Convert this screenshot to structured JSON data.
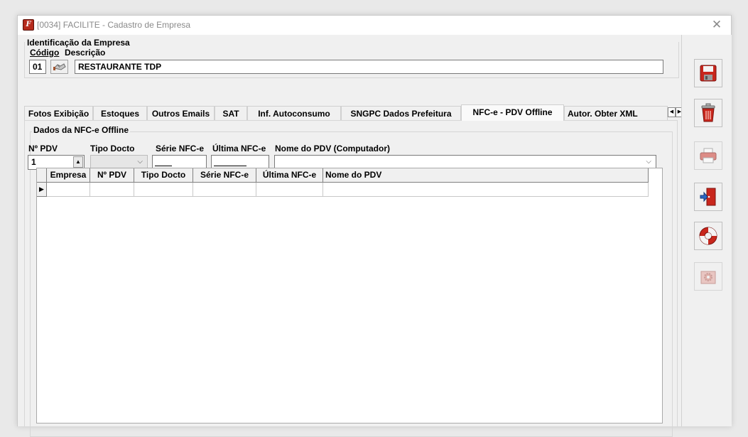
{
  "window": {
    "title": "[0034] FACILITE - Cadastro de Empresa",
    "close_glyph": "✕",
    "app_icon_letter": "F"
  },
  "identificacao": {
    "group_title": "Identificação da Empresa",
    "codigo_label": "Código",
    "descricao_label": "Descrição",
    "codigo_value": "01",
    "descricao_value": "RESTAURANTE TDP"
  },
  "tabs": [
    {
      "label": "Fotos Exibição",
      "active": false
    },
    {
      "label": "Estoques",
      "active": false
    },
    {
      "label": "Outros Emails",
      "active": false
    },
    {
      "label": "SAT",
      "active": false
    },
    {
      "label": "Inf. Autoconsumo",
      "active": false
    },
    {
      "label": "SNGPC Dados Prefeitura",
      "active": false
    },
    {
      "label": "NFC-e - PDV Offline",
      "active": true
    },
    {
      "label": "Autor. Obter XML",
      "active": false
    }
  ],
  "nfce": {
    "group_title": "Dados da NFC-e Offline",
    "npdv_label": "Nº PDV",
    "tipo_docto_label": "Tipo Docto",
    "serie_label": "Série NFC-e",
    "ultima_label": "Última NFC-e",
    "nome_pdv_label": "Nome do PDV (Computador)",
    "npdv_value": "1"
  },
  "grid": {
    "columns": [
      "Empresa",
      "Nº PDV",
      "Tipo Docto",
      "Série NFC-e",
      "Última NFC-e",
      "Nome do PDV"
    ]
  },
  "toolbar": {
    "buttons": [
      {
        "icon": "save-icon",
        "enabled": true
      },
      {
        "icon": "trash-icon",
        "enabled": true
      },
      {
        "icon": "print-icon",
        "enabled": false
      },
      {
        "icon": "exit-icon",
        "enabled": true
      },
      {
        "icon": "help-lifebuoy-icon",
        "enabled": true
      },
      {
        "icon": "settings-icon",
        "enabled": false
      }
    ]
  },
  "colors": {
    "accent_red": "#c8261c",
    "window_bg": "#f0f0f0"
  }
}
